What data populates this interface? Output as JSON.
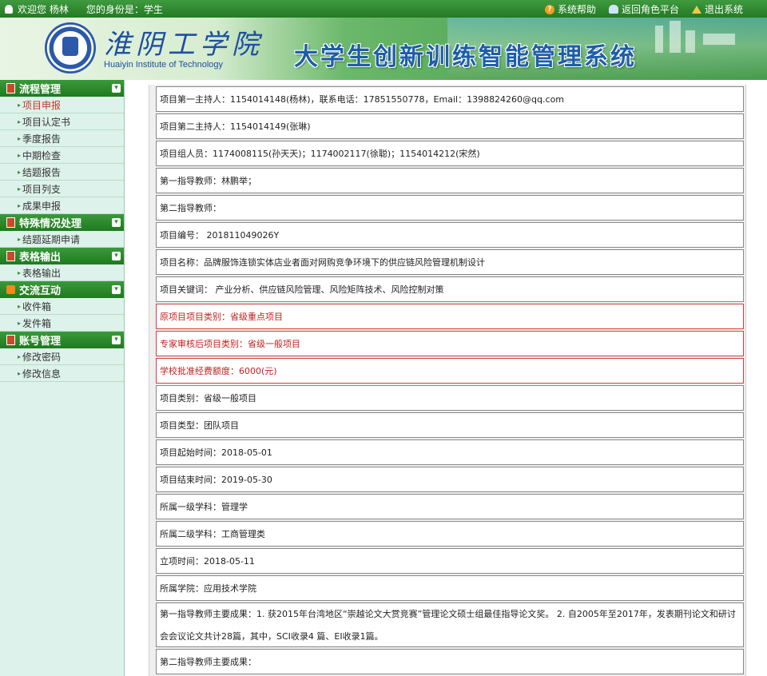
{
  "topbar": {
    "welcome": "欢迎您 杨林",
    "identity": "您的身份是：学生",
    "help": "系统帮助",
    "back_role": "返回角色平台",
    "logout": "退出系统"
  },
  "header": {
    "school_cn": "淮阴工学院",
    "school_en": "Huaiyin Institute of Technology",
    "system_title": "大学生创新训练智能管理系统"
  },
  "sidebar": {
    "sections": [
      {
        "title": "流程管理",
        "items": [
          "项目申报",
          "项目认定书",
          "季度报告",
          "中期检查",
          "结题报告",
          "项目列支",
          "成果申报"
        ]
      },
      {
        "title": "特殊情况处理",
        "items": [
          "结题延期申请"
        ]
      },
      {
        "title": "表格输出",
        "items": [
          "表格输出"
        ]
      },
      {
        "title": "交流互动",
        "items": [
          "收件箱",
          "发件箱"
        ]
      },
      {
        "title": "账号管理",
        "items": [
          "修改密码",
          "修改信息"
        ]
      }
    ]
  },
  "rows": [
    "项目第一主持人：1154014148(杨林)，联系电话：17851550778，Email：1398824260@qq.com",
    "项目第二主持人：1154014149(张琳)",
    "项目组人员：1174008115(孙天天)；1174002117(徐聪)；1154014212(宋然)",
    "第一指导教师：林鹏举；",
    "第二指导教师：",
    "项目编号： 201811049026Y",
    "项目名称：品牌服饰连锁实体店业者面对网购竞争环境下的供应链风险管理机制设计",
    "项目关键词： 产业分析、供应链风险管理、风险矩阵技术、风险控制对策",
    "原项目项目类别：省级重点项目",
    "专家审核后项目类别：省级一般项目",
    "学校批准经费额度：6000(元)",
    "项目类别：省级一般项目",
    "项目类型：团队项目",
    "项目起始时间：2018-05-01",
    "项目结束时间：2019-05-30",
    "所属一级学科：管理学",
    "所属二级学科：工商管理类",
    "立项时间：2018-05-11",
    "所属学院：应用技术学院",
    "第一指导教师主要成果：1. 获2015年台湾地区“崇越论文大赏竞赛”管理论文硕士组最佳指导论文奖。 2. 自2005年至2017年，发表期刊论文和研讨会会议论文共计28篇，其中，SCI收录4 篇、EI收录1篇。",
    "第二指导教师主要成果："
  ]
}
